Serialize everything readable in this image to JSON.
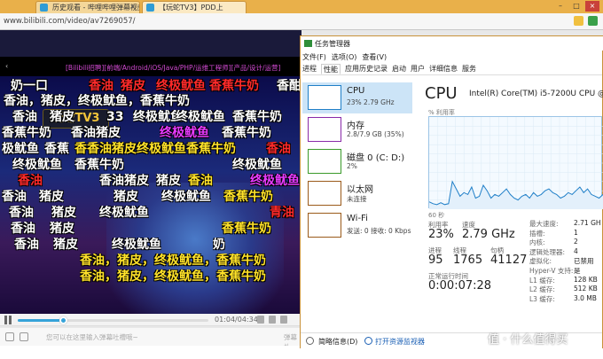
{
  "browser": {
    "tabs": [
      {
        "label": "历史观看 - 哔哩哔哩弹幕视频"
      },
      {
        "label": "【玩蛇TV3】PDD上"
      }
    ],
    "url": "www.bilibili.com/video/av7269057/"
  },
  "player": {
    "title": "[Bilibili招聘][前端/Android/iOS/Java/PHP/运维工程师][产品/设计/运营]",
    "logo_text": "玩蛇TV3",
    "time": "01:04/04:34",
    "progress": 0.235,
    "danmaku_placeholder": "您可以在这里输入弹幕吐槽哦~",
    "danmaku_right": "弹幕礼",
    "danmaku_lines": [
      {
        "text": "奶一口",
        "color": "#ffffff"
      },
      {
        "text": "香油",
        "color": "#ff2a2a"
      },
      {
        "text": "猪皮",
        "color": "#ff2a2a"
      },
      {
        "text": "终极鱿鱼",
        "color": "#ff2a2a"
      },
      {
        "text": "香蕉牛奶",
        "color": "#ff2a2a"
      },
      {
        "text": "香酣",
        "color": "#ffffff"
      },
      {
        "text": "香油，猪皮，终极鱿鱼，香蕉牛奶",
        "color": "#ffffff"
      },
      {
        "text": "终极鱿鱼",
        "color": "#ffffff"
      },
      {
        "text": "香油",
        "color": "#ffffff"
      },
      {
        "text": "猪皮",
        "color": "#ffffff"
      },
      {
        "text": "终极鱿鱼",
        "color": "#ffffff"
      },
      {
        "text": "香蕉牛奶",
        "color": "#ffffff"
      },
      {
        "text": "33",
        "color": "#ffffff"
      },
      {
        "text": "香蕉牛奶",
        "color": "#ffffff"
      },
      {
        "text": "香油猪皮",
        "color": "#ffffff"
      },
      {
        "text": "终极鱿鱼",
        "color": "#e83aff"
      },
      {
        "text": "香蕉牛奶",
        "color": "#ffffff"
      },
      {
        "text": "极鱿鱼",
        "color": "#ffffff"
      },
      {
        "text": "香蕉",
        "color": "#ffffff"
      },
      {
        "text": "香香油猪皮终极鱿鱼香蕉牛奶",
        "color": "#ffe22a"
      },
      {
        "text": "香油",
        "color": "#ff2a2a"
      },
      {
        "text": "终极鱿鱼",
        "color": "#ffffff"
      },
      {
        "text": "香蕉牛奶",
        "color": "#ffffff"
      },
      {
        "text": "终极鱿鱼",
        "color": "#ffffff"
      },
      {
        "text": "香油",
        "color": "#ff2a2a"
      },
      {
        "text": "香油猪皮",
        "color": "#ffffff"
      },
      {
        "text": "猪皮",
        "color": "#ffffff"
      },
      {
        "text": "香油",
        "color": "#ffe22a"
      },
      {
        "text": "终极鱿鱼",
        "color": "#e83aff"
      },
      {
        "text": "香油",
        "color": "#ffffff"
      },
      {
        "text": "猪皮",
        "color": "#ffffff"
      },
      {
        "text": "猪皮",
        "color": "#ffffff"
      },
      {
        "text": "终极鱿鱼",
        "color": "#ffffff"
      },
      {
        "text": "香蕉牛奶",
        "color": "#ffe22a"
      },
      {
        "text": "香油",
        "color": "#ffffff"
      },
      {
        "text": "猪皮",
        "color": "#ffffff"
      },
      {
        "text": "终极鱿鱼",
        "color": "#ffffff"
      },
      {
        "text": "青油",
        "color": "#ff2a2a"
      },
      {
        "text": "香油",
        "color": "#ffffff"
      },
      {
        "text": "猪皮",
        "color": "#ffffff"
      },
      {
        "text": "香蕉牛奶",
        "color": "#ffe22a"
      },
      {
        "text": "香油",
        "color": "#ffffff"
      },
      {
        "text": "猪皮",
        "color": "#ffffff"
      },
      {
        "text": "终极鱿鱼",
        "color": "#ffffff"
      },
      {
        "text": "奶",
        "color": "#ffffff"
      },
      {
        "text": "香油，猪皮，终极鱿鱼，香蕉牛奶",
        "color": "#ffe22a"
      },
      {
        "text": "香油，猪皮，终极鱿鱼，香蕉牛奶",
        "color": "#ffe22a"
      }
    ]
  },
  "task_manager": {
    "title": "任务管理器",
    "menu": [
      "文件(F)",
      "选项(O)",
      "查看(V)"
    ],
    "tabs": [
      "进程",
      "性能",
      "应用历史记录",
      "启动",
      "用户",
      "详细信息",
      "服务"
    ],
    "active_tab": "性能",
    "side": [
      {
        "name": "CPU",
        "sub": "23%  2.79 GHz",
        "color": "#1f7fc8"
      },
      {
        "name": "内存",
        "sub": "2.8/7.9 GB (35%)",
        "color": "#8a2aa8"
      },
      {
        "name": "磁盘 0 (C: D:)",
        "sub": "2%",
        "color": "#3a9a2a"
      },
      {
        "name": "以太网",
        "sub": "未连接",
        "color": "#9a5a1a"
      },
      {
        "name": "Wi-Fi",
        "sub": "发送: 0  接收: 0 Kbps",
        "color": "#9a5a1a"
      }
    ],
    "main": {
      "heading": "CPU",
      "model": "Intel(R) Core(TM) i5-7200U CPU @",
      "util_label": "% 利用率",
      "axis_label": "60 秒",
      "stats": [
        {
          "label": "利用率",
          "value": "23%"
        },
        {
          "label": "速度",
          "value": "2.79 GHz"
        },
        {
          "label": "进程",
          "value": "95"
        },
        {
          "label": "线程",
          "value": "1765"
        },
        {
          "label": "句柄",
          "value": "41127"
        },
        {
          "label": "正常运行时间",
          "value": "0:00:07:28"
        }
      ],
      "specs": [
        {
          "label": "最大速度:",
          "value": "2.71 GH"
        },
        {
          "label": "插槽:",
          "value": "1"
        },
        {
          "label": "内核:",
          "value": "2"
        },
        {
          "label": "逻辑处理器:",
          "value": "4"
        },
        {
          "label": "虚拟化:",
          "value": "已禁用"
        },
        {
          "label": "Hyper-V 支持:",
          "value": "是"
        },
        {
          "label": "L1 缓存:",
          "value": "128 KB"
        },
        {
          "label": "L2 缓存:",
          "value": "512 KB"
        },
        {
          "label": "L3 缓存:",
          "value": "3.0 MB"
        }
      ],
      "graph_values": [
        8,
        6,
        5,
        7,
        5,
        6,
        30,
        22,
        14,
        18,
        16,
        24,
        12,
        14,
        26,
        20,
        12,
        16,
        14,
        18,
        22,
        16,
        12,
        10,
        14,
        16,
        12,
        18,
        14,
        16,
        20,
        22,
        18,
        16,
        12,
        14,
        18,
        16,
        20,
        24,
        18,
        22,
        16,
        14,
        12,
        16
      ]
    },
    "footer": {
      "less": "简略信息(D)",
      "open": "打开资源监视器"
    }
  },
  "watermark": "值 · 什么值得买"
}
